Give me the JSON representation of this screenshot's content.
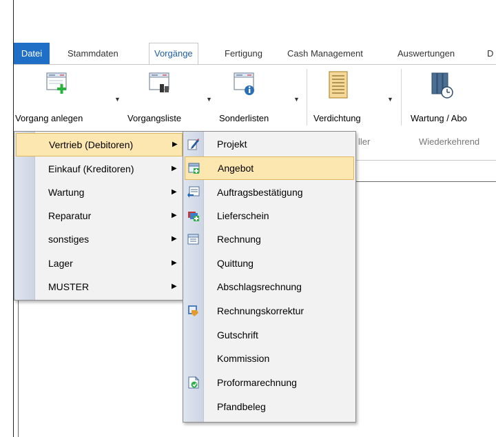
{
  "ribbon": {
    "tabs": [
      {
        "label": "Datei",
        "state": "file"
      },
      {
        "label": "Stammdaten"
      },
      {
        "label": "Vorgänge",
        "state": "active"
      },
      {
        "label": "Fertigung"
      },
      {
        "label": "Cash Management"
      },
      {
        "label": "Auswertungen"
      },
      {
        "label": "D"
      }
    ],
    "buttons": [
      {
        "label": "Vorgang anlegen",
        "icon": "document-add-icon"
      },
      {
        "label": "Vorgangsliste",
        "icon": "document-list-icon"
      },
      {
        "label": "Sonderlisten",
        "icon": "document-info-icon"
      },
      {
        "label": "Verdichtung",
        "icon": "summary-sheet-icon"
      },
      {
        "label": "Wartung / Abo",
        "icon": "binders-clock-icon"
      }
    ],
    "group_labels": {
      "partial": "ller",
      "recurring": "Wiederkehrend"
    }
  },
  "menu_primary": {
    "items": [
      {
        "label": "Vertrieb (Debitoren)",
        "highlighted": true
      },
      {
        "label": "Einkauf (Kreditoren)"
      },
      {
        "label": "Wartung"
      },
      {
        "label": "Reparatur"
      },
      {
        "label": "sonstiges"
      },
      {
        "label": "Lager"
      },
      {
        "label": "MUSTER"
      }
    ],
    "arrow_glyph": "▶"
  },
  "menu_sub": {
    "items": [
      {
        "label": "Projekt",
        "icon": "pencil-edit-icon"
      },
      {
        "label": "Angebot",
        "icon": "offer-document-icon",
        "highlighted": true
      },
      {
        "label": "Auftragsbestätigung",
        "icon": "order-confirm-icon"
      },
      {
        "label": "Lieferschein",
        "icon": "delivery-note-icon"
      },
      {
        "label": "Rechnung",
        "icon": "invoice-icon"
      },
      {
        "label": "Quittung",
        "icon": ""
      },
      {
        "label": "Abschlagsrechnung",
        "icon": ""
      },
      {
        "label": "Rechnungskorrektur",
        "icon": "invoice-correction-icon"
      },
      {
        "label": "Gutschrift",
        "icon": ""
      },
      {
        "label": "Kommission",
        "icon": ""
      },
      {
        "label": "Proformarechnung",
        "icon": "proforma-icon"
      },
      {
        "label": "Pfandbeleg",
        "icon": ""
      }
    ]
  },
  "colors": {
    "file_tab": "#1f6fc6",
    "active_tab_text": "#1f5ea8",
    "highlight_bg": "#fde7b0",
    "highlight_border": "#e0b85a"
  }
}
